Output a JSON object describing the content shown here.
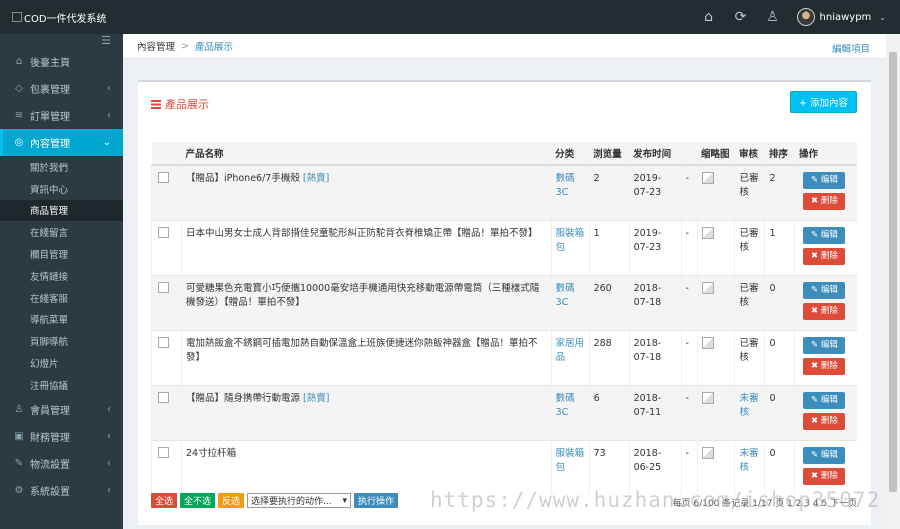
{
  "header": {
    "logo_text": "COD一件代发系统",
    "username": "hniawypm"
  },
  "sidebar": {
    "items": [
      {
        "label": "後臺主頁",
        "icon": "home-icon"
      },
      {
        "label": "包裹管理",
        "icon": "gem-icon"
      },
      {
        "label": "訂單管理",
        "icon": "layers-icon"
      },
      {
        "label": "內容管理",
        "icon": "dribbble-icon"
      }
    ],
    "sub_items": [
      "關於我們",
      "資訊中心",
      "商品管理",
      "在綫留言",
      "欄目管理",
      "友情鏈接",
      "在綫客服",
      "導航菜單",
      "頁脚導航",
      "幻燈片",
      "注冊協議"
    ],
    "bottom_items": [
      {
        "label": "會員管理",
        "icon": "user-icon"
      },
      {
        "label": "財務管理",
        "icon": "wallet-icon"
      },
      {
        "label": "物流設置",
        "icon": "wrench-icon"
      },
      {
        "label": "系統設置",
        "icon": "gear-icon"
      }
    ]
  },
  "breadcrumb": {
    "parent": "內容管理",
    "current": "產品展示",
    "edit": "編輯項目"
  },
  "panel": {
    "title": "產品展示",
    "add_button": "+ 添加內容"
  },
  "table": {
    "headers": [
      "产品名称",
      "分类",
      "浏览量",
      "发布时间",
      "",
      "缩略图",
      "审核",
      "排序",
      "操作"
    ],
    "edit_label": "编辑",
    "delete_label": "删除",
    "rows": [
      {
        "name": "【贈品】iPhone6/7手機殼",
        "hot": "[熱賣]",
        "cat": "數碼3C",
        "views": "2",
        "date": "2019-07-23",
        "dash": "-",
        "audit": "已審核",
        "audit_ok": true,
        "sort": "2"
      },
      {
        "name": "日本中山男女士成人背部揹佳兒童駝形糾正防駝背衣脊椎矯正帶【贈品！單拍不發】",
        "hot": "",
        "cat": "服裝箱包",
        "views": "1",
        "date": "2019-07-23",
        "dash": "-",
        "audit": "已審核",
        "audit_ok": true,
        "sort": "1"
      },
      {
        "name": "可愛糖果色充電寶小巧便攜10000毫安培手機通用快充移動電源帶電筒（三種樣式隨機發送）【贈品！單拍不發】",
        "hot": "",
        "cat": "數碼3C",
        "views": "260",
        "date": "2018-07-18",
        "dash": "-",
        "audit": "已審核",
        "audit_ok": true,
        "sort": "0"
      },
      {
        "name": "電加熱飯盒不銹鋼可插電加熱自動保溫盒上班族便捷迷你熱飯神器盒【贈品！單拍不發】",
        "hot": "",
        "cat": "家居用品",
        "views": "288",
        "date": "2018-07-18",
        "dash": "-",
        "audit": "已審核",
        "audit_ok": true,
        "sort": "0"
      },
      {
        "name": "【贈品】隨身携帶行動電源",
        "hot": "[熱賣]",
        "cat": "數碼3C",
        "views": "6",
        "date": "2018-07-11",
        "dash": "-",
        "audit": "未審核",
        "audit_ok": false,
        "sort": "0"
      },
      {
        "name": "24寸拉杆箱",
        "hot": "",
        "cat": "服裝箱包",
        "views": "73",
        "date": "2018-06-25",
        "dash": "-",
        "audit": "未審核",
        "audit_ok": false,
        "sort": "0"
      }
    ]
  },
  "footer": {
    "select_all": "全选",
    "deselect": "全不选",
    "invert": "反选",
    "action_select": "选择要执行的动作...",
    "execute": "执行操作",
    "pager": "每页 6/100 条记录 1/17 页 1 2 3 4 5 下一页"
  },
  "watermark": "https://www.huzhan.com/ishop35072"
}
